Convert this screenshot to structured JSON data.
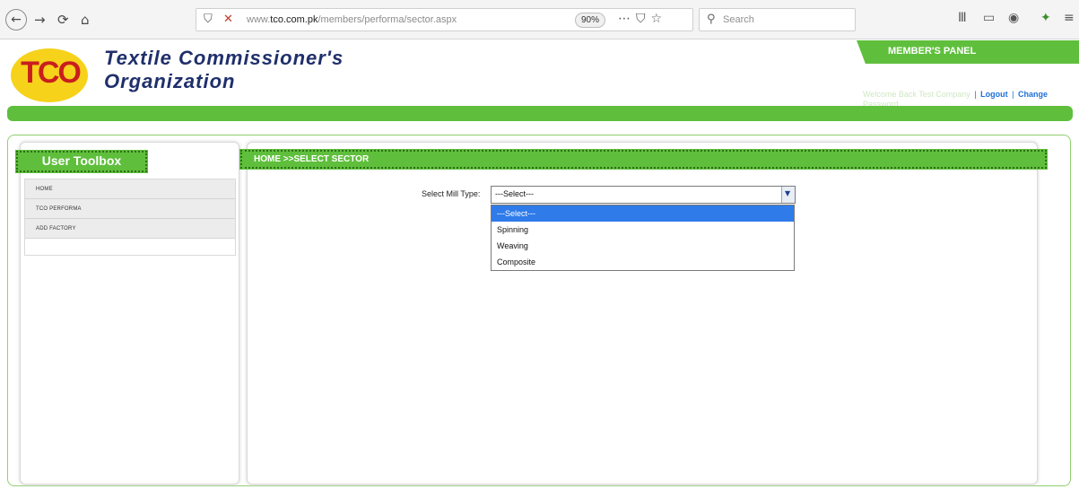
{
  "browser": {
    "url_prefix": "www.",
    "url_domain": "tco.com.pk",
    "url_path": "/members/performa/sector.aspx",
    "zoom": "90%",
    "search_placeholder": "Search",
    "icons": {
      "back": "←",
      "forward": "→",
      "reload": "⟳",
      "home": "⌂",
      "shield": "⛉",
      "page_actions": "⋯",
      "pocket": "⛉",
      "star": "☆",
      "search": "⚲",
      "library": "Ⅲ",
      "sidebar": "▭",
      "account": "◉",
      "extension": "✦",
      "menu": "≡"
    }
  },
  "header": {
    "logo_text": "TCO",
    "org_line1": "Textile Commissioner's",
    "org_line2": "Organization",
    "member_panel": "MEMBER'S PANEL",
    "welcome_text": "Welcome Back Test Company",
    "logout": "Logout",
    "change_password_line1": "Change",
    "change_password_line2": "Password",
    "separator": "|"
  },
  "sidebar": {
    "title": "User Toolbox",
    "items": [
      {
        "label": "HOME"
      },
      {
        "label": "TCO PERFORMA"
      },
      {
        "label": "ADD FACTORY"
      }
    ]
  },
  "main": {
    "breadcrumb": "HOME >>SELECT SECTOR",
    "field_label": "Select Mill Type:",
    "selected_value": "---Select---",
    "options": [
      "---Select---",
      "Spinning",
      "Weaving",
      "Composite"
    ]
  },
  "colors": {
    "brand_green": "#5fbf3c",
    "brand_navy": "#1f2f6b",
    "logo_yellow": "#f6d21a",
    "logo_red": "#c91e1e",
    "option_highlight": "#2f7bea",
    "link_blue": "#1e6fd9"
  }
}
